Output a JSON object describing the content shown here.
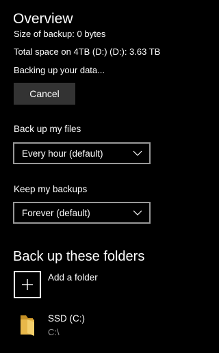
{
  "overview": {
    "title": "Overview",
    "size_text": "Size of backup: 0 bytes",
    "total_text": "Total space on 4TB (D:) (D:): 3.63 TB",
    "status_text": "Backing up your data...",
    "cancel_label": "Cancel"
  },
  "backup_files": {
    "label": "Back up my files",
    "selected": "Every hour (default)"
  },
  "keep_backups": {
    "label": "Keep my backups",
    "selected": "Forever (default)"
  },
  "folders": {
    "title": "Back up these folders",
    "add_label": "Add a folder",
    "items": [
      {
        "name": "SSD (C:)",
        "path": "C:\\"
      }
    ]
  },
  "icons": {
    "dropdown": "chevron-down-icon",
    "add": "plus-icon",
    "folder": "folder-icon"
  },
  "colors": {
    "background": "#000000",
    "button": "#333333",
    "select_border": "#999999",
    "folder": "#e8b84a",
    "secondary_text": "#999999"
  }
}
